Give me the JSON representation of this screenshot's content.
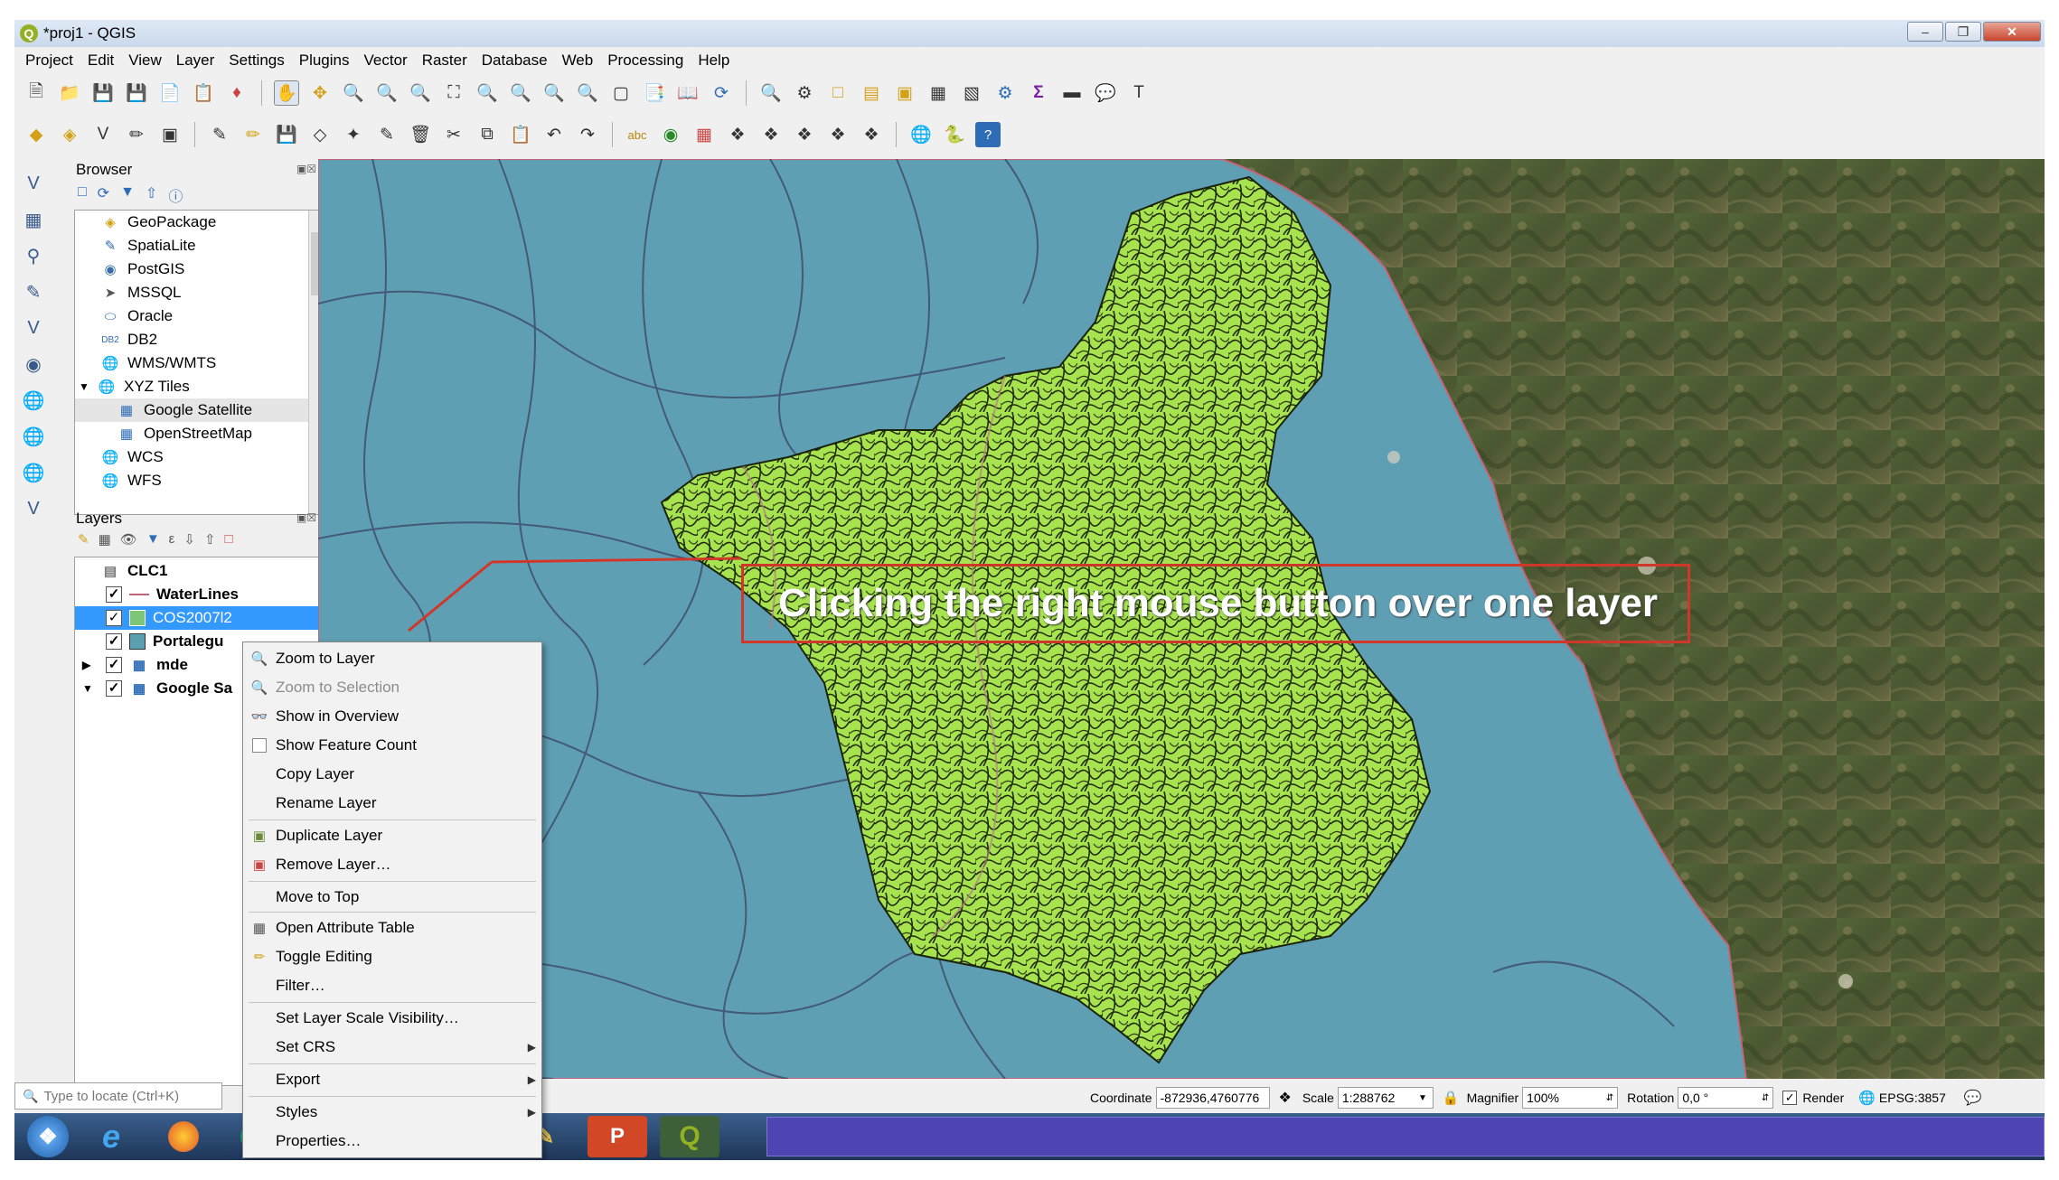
{
  "window": {
    "title": "*proj1 - QGIS"
  },
  "menubar": [
    "Project",
    "Edit",
    "View",
    "Layer",
    "Settings",
    "Plugins",
    "Vector",
    "Raster",
    "Database",
    "Web",
    "Processing",
    "Help"
  ],
  "browser": {
    "title": "Browser",
    "items": [
      {
        "label": "GeoPackage",
        "icon": "geopackage-icon"
      },
      {
        "label": "SpatiaLite",
        "icon": "spatialite-icon"
      },
      {
        "label": "PostGIS",
        "icon": "postgis-icon"
      },
      {
        "label": "MSSQL",
        "icon": "mssql-icon"
      },
      {
        "label": "Oracle",
        "icon": "oracle-icon"
      },
      {
        "label": "DB2",
        "icon": "db2-icon"
      },
      {
        "label": "WMS/WMTS",
        "icon": "wms-icon"
      },
      {
        "label": "XYZ Tiles",
        "icon": "xyz-icon"
      },
      {
        "label": "Google Satellite",
        "icon": "tiles-icon"
      },
      {
        "label": "OpenStreetMap",
        "icon": "tiles-icon"
      },
      {
        "label": "WCS",
        "icon": "wcs-icon"
      },
      {
        "label": "WFS",
        "icon": "wfs-icon"
      }
    ]
  },
  "layers": {
    "title": "Layers",
    "items": [
      {
        "label": "CLC1",
        "checked": false
      },
      {
        "label": "WaterLines",
        "checked": true
      },
      {
        "label": "COS2007l2",
        "checked": true
      },
      {
        "label": "Portalegu",
        "checked": true
      },
      {
        "label": "mde",
        "checked": true
      },
      {
        "label": "Google Sa",
        "checked": true
      }
    ]
  },
  "locate": {
    "placeholder": "Type to locate (Ctrl+K)"
  },
  "annotation": {
    "text": "Clicking the right mouse button over one layer"
  },
  "context_menu": {
    "items": [
      {
        "label": "Zoom to Layer"
      },
      {
        "label": "Zoom to Selection"
      },
      {
        "label": "Show in Overview"
      },
      {
        "label": "Show Feature Count"
      },
      {
        "label": "Copy Layer"
      },
      {
        "label": "Rename Layer"
      },
      {
        "label": "Duplicate Layer"
      },
      {
        "label": "Remove Layer…"
      },
      {
        "label": "Move to Top"
      },
      {
        "label": "Open Attribute Table"
      },
      {
        "label": "Toggle Editing"
      },
      {
        "label": "Filter…"
      },
      {
        "label": "Set Layer Scale Visibility…"
      },
      {
        "label": "Set CRS"
      },
      {
        "label": "Export"
      },
      {
        "label": "Styles"
      },
      {
        "label": "Properties…"
      }
    ]
  },
  "statusbar": {
    "coordinate_label": "Coordinate",
    "coordinate_value": "-872936,4760776",
    "scale_label": "Scale",
    "scale_value": "1:288762",
    "magnifier_label": "Magnifier",
    "magnifier_value": "100%",
    "rotation_label": "Rotation",
    "rotation_value": "0,0 °",
    "render_label": "Render",
    "crs": "EPSG:3857"
  },
  "colors": {
    "map_water": "#5f9fb4",
    "polygon_fill": "#a6e34f",
    "annotation_border": "#d0372b",
    "selection": "#3399ff"
  }
}
